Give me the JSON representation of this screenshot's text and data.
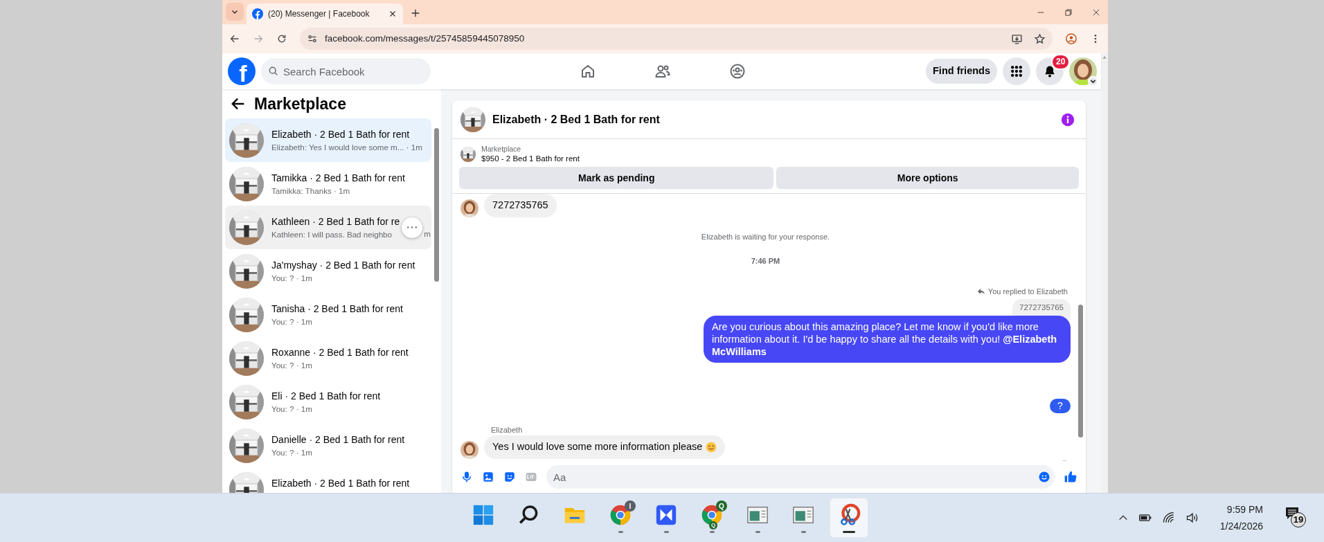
{
  "browser": {
    "tab_title": "(20) Messenger | Facebook",
    "url": "facebook.com/messages/t/25745859445078950"
  },
  "facebook": {
    "logo": "f",
    "search": {
      "placeholder": "Search Facebook"
    },
    "nav": [
      {
        "kind": "home"
      },
      {
        "kind": "friends"
      },
      {
        "kind": "groups"
      }
    ],
    "find_friends": "Find friends",
    "notifications_badge": "20"
  },
  "sidebar": {
    "title": "Marketplace",
    "items": [
      {
        "name": "Elizabeth · 2 Bed 1 Bath for rent",
        "preview": "Elizabeth: Yes I would love some m... · 1m",
        "selected": true,
        "hovered": false
      },
      {
        "name": "Tamikka · 2 Bed 1 Bath for rent",
        "preview": "Tamikka: Thanks · 1m",
        "selected": false,
        "hovered": false
      },
      {
        "name": "Kathleen · 2 Bed 1 Bath for re",
        "preview": "Kathleen: I will pass. Bad neighbo",
        "preview_tail": "m",
        "selected": false,
        "hovered": true
      },
      {
        "name": "Ja'myshay · 2 Bed 1 Bath for rent",
        "preview": "You: ? · 1m",
        "selected": false,
        "hovered": false
      },
      {
        "name": "Tanisha · 2 Bed 1 Bath for rent",
        "preview": "You: ? · 1m",
        "selected": false,
        "hovered": false
      },
      {
        "name": "Roxanne · 2 Bed 1 Bath for rent",
        "preview": "You: ? · 1m",
        "selected": false,
        "hovered": false
      },
      {
        "name": "Eli · 2 Bed 1 Bath for rent",
        "preview": "You: ? · 1m",
        "selected": false,
        "hovered": false
      },
      {
        "name": "Danielle · 2 Bed 1 Bath for rent",
        "preview": "You: ? · 1m",
        "selected": false,
        "hovered": false
      },
      {
        "name": "Elizabeth · 2 Bed 1 Bath for rent",
        "selected": false,
        "hovered": false
      }
    ]
  },
  "chat": {
    "title": "Elizabeth · 2 Bed 1 Bath for rent",
    "listing": {
      "label": "Marketplace",
      "text": "$950 - 2 Bed 1 Bath for rent"
    },
    "actions": [
      "Mark as pending",
      "More options"
    ],
    "messages": [
      {
        "kind": "received",
        "text": "7272735765",
        "emoji": false
      },
      {
        "kind": "notice",
        "text": "Elizabeth is waiting for your response."
      },
      {
        "kind": "time",
        "text": "7:46 PM"
      },
      {
        "kind": "reply_note",
        "text": "You replied to Elizabeth"
      },
      {
        "kind": "quote",
        "text": "7272735765"
      },
      {
        "kind": "sent",
        "text": "Are you curious about this amazing place? Let me know if you'd like more information about it. I'd be happy to share all the details with you! **@Elizabeth McWilliams**"
      },
      {
        "kind": "sent_short",
        "text": "?"
      },
      {
        "kind": "sender",
        "text": "Elizabeth"
      },
      {
        "kind": "received",
        "text": "Yes I would love some more information please",
        "emoji": true
      },
      {
        "kind": "seen"
      }
    ],
    "composer": {
      "placeholder": "Aa"
    }
  },
  "taskbar": {
    "apps": [
      {
        "kind": "start",
        "running": false,
        "active": false
      },
      {
        "kind": "search",
        "running": false,
        "active": false
      },
      {
        "kind": "explorer",
        "running": false,
        "active": false
      },
      {
        "kind": "chrome",
        "running": true,
        "active": false,
        "badges": [
          "I"
        ]
      },
      {
        "kind": "bowtie",
        "running": true,
        "active": false
      },
      {
        "kind": "chrome",
        "running": true,
        "active": false,
        "badges": [
          "Q",
          "Q"
        ]
      },
      {
        "kind": "window",
        "running": true,
        "active": false
      },
      {
        "kind": "window",
        "running": true,
        "active": false
      },
      {
        "kind": "snipping",
        "running": true,
        "active": true
      }
    ],
    "time": "9:59 PM",
    "date": "1/24/2026",
    "notification_count": "19"
  }
}
